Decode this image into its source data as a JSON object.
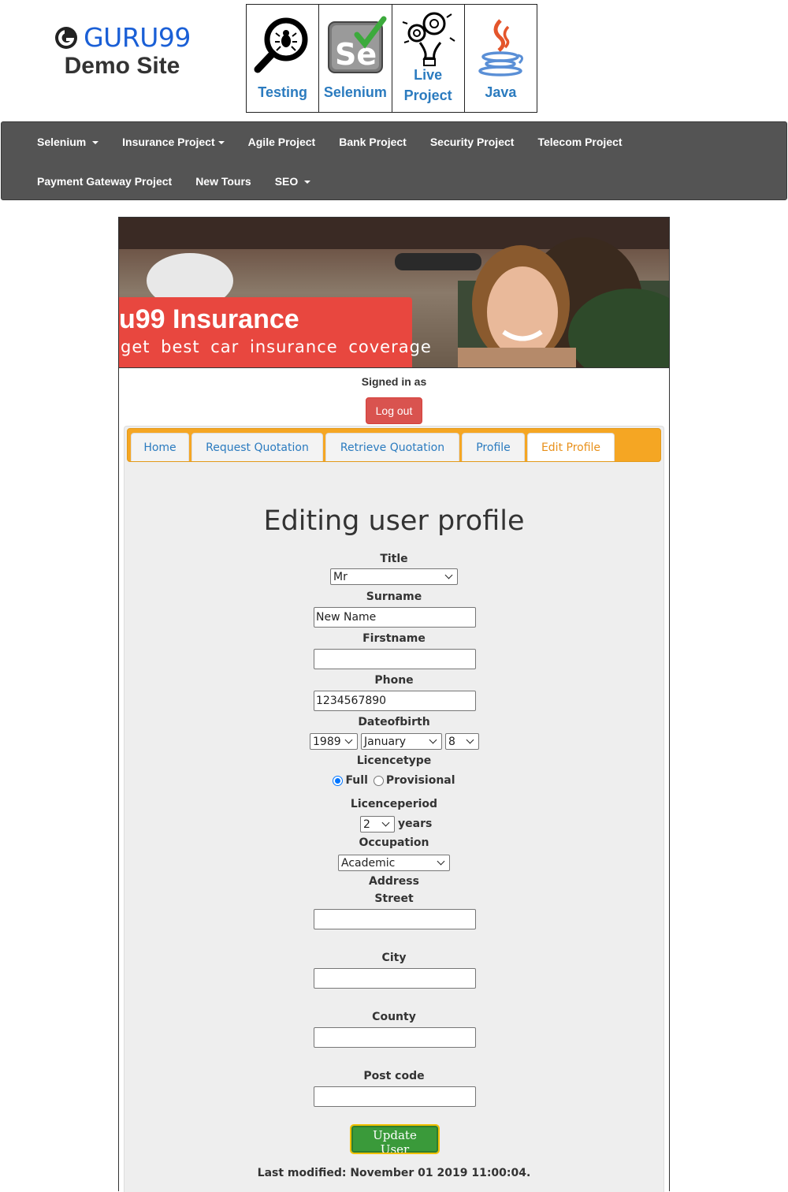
{
  "header": {
    "logo_text": "GURU99",
    "logo_subtitle": "Demo Site",
    "tiles": [
      {
        "label": "Testing",
        "icon": "magnifier-bug-icon"
      },
      {
        "label": "Selenium",
        "icon": "selenium-icon"
      },
      {
        "label": "Live Project",
        "icon": "gears-bulb-icon"
      },
      {
        "label": "Java",
        "icon": "java-icon"
      }
    ]
  },
  "nav": {
    "row1": [
      "Selenium",
      "Insurance Project",
      "Agile Project",
      "Bank Project",
      "Security Project",
      "Telecom Project"
    ],
    "row2": [
      "Payment Gateway Project",
      "New Tours",
      "SEO"
    ]
  },
  "banner": {
    "title": "u99 Insurance",
    "tagline": "get best car insurance coverage"
  },
  "session": {
    "signed_in_label": "Signed in as",
    "logout_label": "Log out"
  },
  "tabs": [
    "Home",
    "Request Quotation",
    "Retrieve Quotation",
    "Profile",
    "Edit Profile"
  ],
  "form": {
    "heading": "Editing user profile",
    "title_label": "Title",
    "title_value": "Mr",
    "surname_label": "Surname",
    "surname_value": "New Name",
    "firstname_label": "Firstname",
    "firstname_value": "",
    "phone_label": "Phone",
    "phone_value": "1234567890",
    "dob_label": "Dateofbirth",
    "dob_year": "1989",
    "dob_month": "January",
    "dob_day": "8",
    "licence_type_label": "Licencetype",
    "licence_full": "Full",
    "licence_provisional": "Provisional",
    "licence_period_label": "Licenceperiod",
    "licence_period_value": "2",
    "years_label": "years",
    "occupation_label": "Occupation",
    "occupation_value": "Academic",
    "address_label": "Address",
    "street_label": "Street",
    "city_label": "City",
    "county_label": "County",
    "postcode_label": "Post code",
    "update_label": "Update User",
    "last_modified": "Last modified: November 01 2019 11:00:04."
  }
}
